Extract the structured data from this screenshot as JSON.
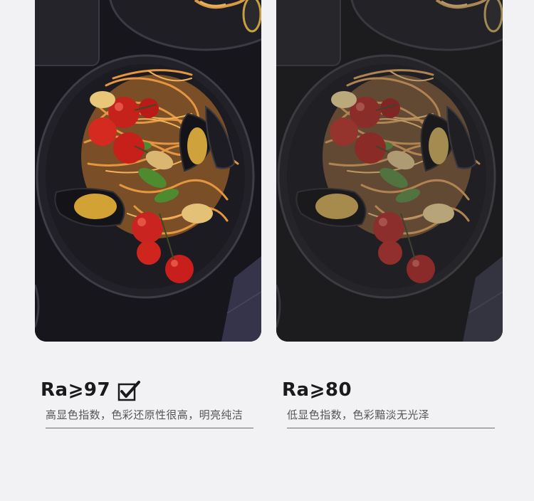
{
  "comparisons": [
    {
      "heading": "Ra⩾97",
      "description": "高显色指数，色彩还原性很高，明亮纯洁",
      "checked": true,
      "icon": "checkbox-checked-icon"
    },
    {
      "heading": "Ra⩾80",
      "description": "低显色指数，色彩黯淡无光泽",
      "checked": false
    }
  ],
  "colors": {
    "background": "#f2f1f3",
    "heading": "#1a1a1a",
    "description": "#555555",
    "divider": "#6e6e6e"
  }
}
